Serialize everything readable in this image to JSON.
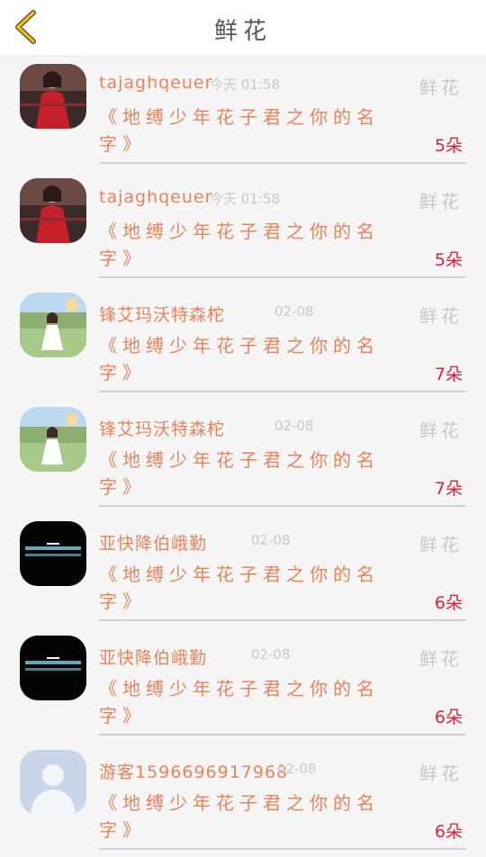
{
  "header": {
    "title": "鲜花",
    "back_icon": "chevron-left-icon"
  },
  "colors": {
    "accent": "#e8825a",
    "count": "#d4243c",
    "muted": "#c8c8c8",
    "back": "#f1c400"
  },
  "items": [
    {
      "name": "tajaghqeuer",
      "time": "今天 01:58",
      "tag": "鲜花",
      "message": "《地缚少年花子君之你的名字》",
      "count": "5朵",
      "avatar": "red-dress-girl"
    },
    {
      "name": "tajaghqeuer",
      "time": "今天 01:58",
      "tag": "鲜花",
      "message": "《地缚少年花子君之你的名字》",
      "count": "5朵",
      "avatar": "red-dress-girl"
    },
    {
      "name": "锋艾玛沃特森柁",
      "time": "02-08",
      "tag": "鲜花",
      "message": "《地缚少年花子君之你的名字》",
      "count": "7朵",
      "avatar": "white-dress-girl"
    },
    {
      "name": "锋艾玛沃特森柁",
      "time": "02-08",
      "tag": "鲜花",
      "message": "《地缚少年花子君之你的名字》",
      "count": "7朵",
      "avatar": "white-dress-girl"
    },
    {
      "name": "亚快降伯峨勤",
      "time": "02-08",
      "tag": "鲜花",
      "message": "《地缚少年花子君之你的名字》",
      "count": "6朵",
      "avatar": "dark-text-image"
    },
    {
      "name": "亚快降伯峨勤",
      "time": "02-08",
      "tag": "鲜花",
      "message": "《地缚少年花子君之你的名字》",
      "count": "6朵",
      "avatar": "dark-text-image"
    },
    {
      "name": "游客1596696917968",
      "time": "02-08",
      "tag": "鲜花",
      "message": "《地缚少年花子君之你的名字》",
      "count": "6朵",
      "avatar": "default-user"
    }
  ]
}
